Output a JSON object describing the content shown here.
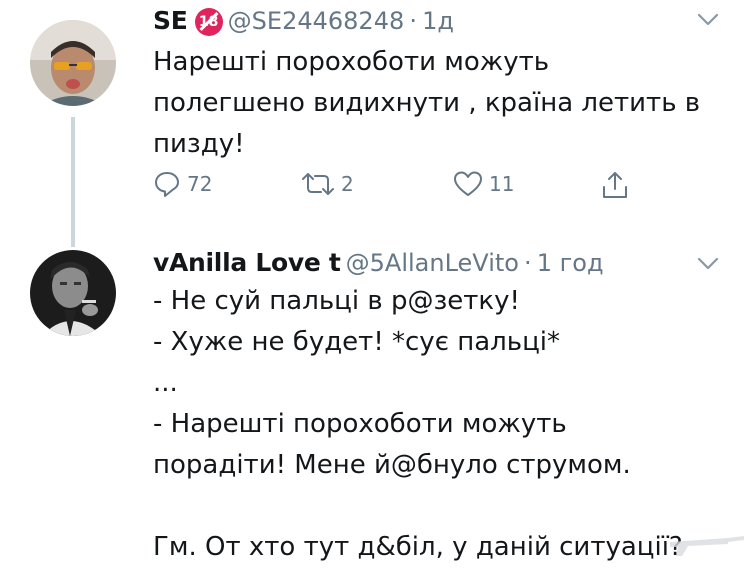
{
  "tweet1": {
    "name": "SE",
    "badge": "18",
    "handle": "@SE24468248",
    "dot": "·",
    "time": "1д",
    "text_lines": [
      "Нарешті порохоботи можуть",
      "полегшено видихнути , країна летить в",
      "пизду!"
    ],
    "actions": {
      "reply_count": "72",
      "retweet_count": "2",
      "like_count": "11"
    }
  },
  "tweet2": {
    "name": "vAnilla Love t",
    "handle": "@5AllanLeVito",
    "dot": "·",
    "time": "1 год",
    "text_lines": [
      "- Не суй пальці в р@зетку!",
      "- Хуже не будет! *сує пальці*",
      "...",
      "- Нарешті порохоботи можуть",
      "порадіти! Мене й@бнуло струмом.",
      "",
      "Гм. От хто тут д&біл, у даній ситуації?"
    ]
  },
  "colors": {
    "text": "#14171a",
    "secondary": "#657786",
    "thread_line": "#ccd6dd",
    "badge": "#e0245e"
  },
  "icons": [
    "reply-icon",
    "retweet-icon",
    "like-icon",
    "share-icon",
    "chevron-down-icon"
  ]
}
